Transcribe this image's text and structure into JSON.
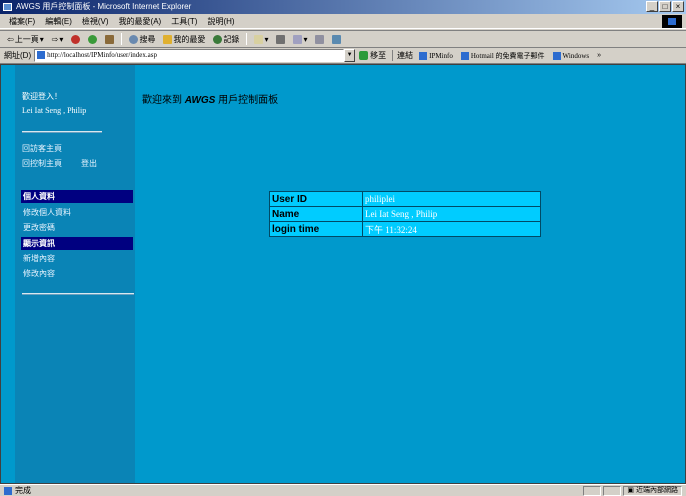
{
  "window": {
    "title": "AWGS 用戶控制面板 - Microsoft Internet Explorer",
    "controls": [
      "_",
      "□",
      "×"
    ]
  },
  "menu": [
    "檔案(F)",
    "編輯(E)",
    "檢視(V)",
    "我的最愛(A)",
    "工具(T)",
    "說明(H)"
  ],
  "toolbar": {
    "back": "上一頁",
    "search": "搜尋",
    "favorites": "我的最愛",
    "history": "記錄"
  },
  "address": {
    "label": "網址(D)",
    "url": "http://localhost/IPMinfo/user/index.asp",
    "go": "移至",
    "links_label": "連結",
    "links": [
      "IPMinfo",
      "Hotmail 的免費電子郵件",
      "Windows"
    ],
    "more": "»"
  },
  "sidebar": {
    "greeting": "歡迎登入！",
    "user": "Lei Iat Seng , Philip",
    "link_home": "回訪客主頁",
    "link_control": "回控制主頁",
    "link_logout": "登出",
    "section_personal": "個人資料",
    "item_edit_personal": "修改個人資料",
    "item_change_password": "更改密碼",
    "section_display": "顯示資訊",
    "item_add": "新增內容",
    "item_edit": "修改內容"
  },
  "page": {
    "title_prefix": "歡迎來到",
    "title_brand": "AWGS",
    "title_suffix": "用戶控制面板"
  },
  "info": [
    {
      "key": "User ID",
      "value": "philiplei"
    },
    {
      "key": "Name",
      "value": "Lei Iat Seng , Philip"
    },
    {
      "key": "login time",
      "value": "下午 11:32:24"
    }
  ],
  "status": {
    "text": "完成",
    "zone": "近端內部網路"
  }
}
